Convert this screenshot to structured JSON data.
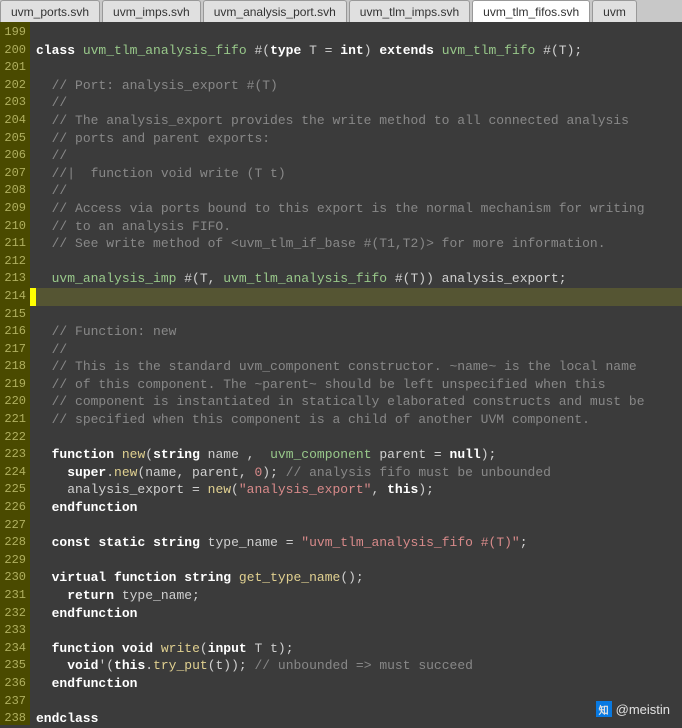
{
  "tabs": [
    {
      "label": "uvm_ports.svh",
      "active": false
    },
    {
      "label": "uvm_imps.svh",
      "active": false
    },
    {
      "label": "uvm_analysis_port.svh",
      "active": false
    },
    {
      "label": "uvm_tlm_imps.svh",
      "active": false
    },
    {
      "label": "uvm_tlm_fifos.svh",
      "active": true
    },
    {
      "label": "uvm",
      "active": false
    }
  ],
  "gutter": {
    "start": 199,
    "end": 238
  },
  "code_lines": [
    {
      "n": 199,
      "html": ""
    },
    {
      "n": 200,
      "html": "<span class='kw'>class</span> <span class='type'>uvm_tlm_analysis_fifo</span> #(<span class='kw'>type</span> T = <span class='kw'>int</span>) <span class='kw'>extends</span> <span class='type'>uvm_tlm_fifo</span> #(T);"
    },
    {
      "n": 201,
      "html": ""
    },
    {
      "n": 202,
      "html": "  <span class='c1'>// Port: analysis_export #(T)</span>"
    },
    {
      "n": 203,
      "html": "  <span class='c1'>//</span>"
    },
    {
      "n": 204,
      "html": "  <span class='c1'>// The analysis_export provides the write method to all connected analysis</span>"
    },
    {
      "n": 205,
      "html": "  <span class='c1'>// ports and parent exports:</span>"
    },
    {
      "n": 206,
      "html": "  <span class='c1'>//</span>"
    },
    {
      "n": 207,
      "html": "  <span class='c1'>//|  function void write (T t)</span>"
    },
    {
      "n": 208,
      "html": "  <span class='c1'>//</span>"
    },
    {
      "n": 209,
      "html": "  <span class='c1'>// Access via ports bound to this export is the normal mechanism for writing</span>"
    },
    {
      "n": 210,
      "html": "  <span class='c1'>// to an analysis FIFO.</span>"
    },
    {
      "n": 211,
      "html": "  <span class='c1'>// See write method of &lt;uvm_tlm_if_base #(T1,T2)&gt; for more information.</span>"
    },
    {
      "n": 212,
      "html": ""
    },
    {
      "n": 213,
      "html": "  <span class='type'>uvm_analysis_imp</span> #(T, <span class='type'>uvm_tlm_analysis_fifo</span> #(T)) analysis_export;"
    },
    {
      "n": 214,
      "html": "",
      "hl": true,
      "cursor": true
    },
    {
      "n": 215,
      "html": ""
    },
    {
      "n": 216,
      "html": "  <span class='c1'>// Function: new</span>"
    },
    {
      "n": 217,
      "html": "  <span class='c1'>//</span>"
    },
    {
      "n": 218,
      "html": "  <span class='c1'>// This is the standard uvm_component constructor. ~name~ is the local name</span>"
    },
    {
      "n": 219,
      "html": "  <span class='c1'>// of this component. The ~parent~ should be left unspecified when this</span>"
    },
    {
      "n": 220,
      "html": "  <span class='c1'>// component is instantiated in statically elaborated constructs and must be</span>"
    },
    {
      "n": 221,
      "html": "  <span class='c1'>// specified when this component is a child of another UVM component.</span>"
    },
    {
      "n": 222,
      "html": ""
    },
    {
      "n": 223,
      "html": "  <span class='kw'>function</span> <span class='fn'>new</span>(<span class='kw'>string</span> name ,  <span class='type'>uvm_component</span> parent = <span class='kw'>null</span>);"
    },
    {
      "n": 224,
      "html": "    <span class='kw'>super</span>.<span class='fn'>new</span>(name, parent, <span class='num'>0</span>); <span class='c1'>// analysis fifo must be unbounded</span>"
    },
    {
      "n": 225,
      "html": "    analysis_export = <span class='fn'>new</span>(<span class='str'>\"analysis_export\"</span>, <span class='kw'>this</span>);"
    },
    {
      "n": 226,
      "html": "  <span class='kw'>endfunction</span>"
    },
    {
      "n": 227,
      "html": ""
    },
    {
      "n": 228,
      "html": "  <span class='kw'>const</span> <span class='kw'>static</span> <span class='kw'>string</span> type_name = <span class='str'>\"uvm_tlm_analysis_fifo #(T)\"</span>;"
    },
    {
      "n": 229,
      "html": ""
    },
    {
      "n": 230,
      "html": "  <span class='kw'>virtual</span> <span class='kw'>function</span> <span class='kw'>string</span> <span class='fn'>get_type_name</span>();"
    },
    {
      "n": 231,
      "html": "    <span class='kw'>return</span> type_name;"
    },
    {
      "n": 232,
      "html": "  <span class='kw'>endfunction</span>"
    },
    {
      "n": 233,
      "html": ""
    },
    {
      "n": 234,
      "html": "  <span class='kw'>function</span> <span class='kw'>void</span> <span class='fn'>write</span>(<span class='kw'>input</span> T t);"
    },
    {
      "n": 235,
      "html": "    <span class='kw'>void</span>'(<span class='kw'>this</span>.<span class='fn'>try_put</span>(t)); <span class='c1'>// unbounded =&gt; must succeed</span>"
    },
    {
      "n": 236,
      "html": "  <span class='kw'>endfunction</span>"
    },
    {
      "n": 237,
      "html": ""
    },
    {
      "n": 238,
      "html": "<span class='kw'>endclass</span>"
    }
  ],
  "watermark": {
    "text": "@meistin",
    "icon": "知"
  }
}
